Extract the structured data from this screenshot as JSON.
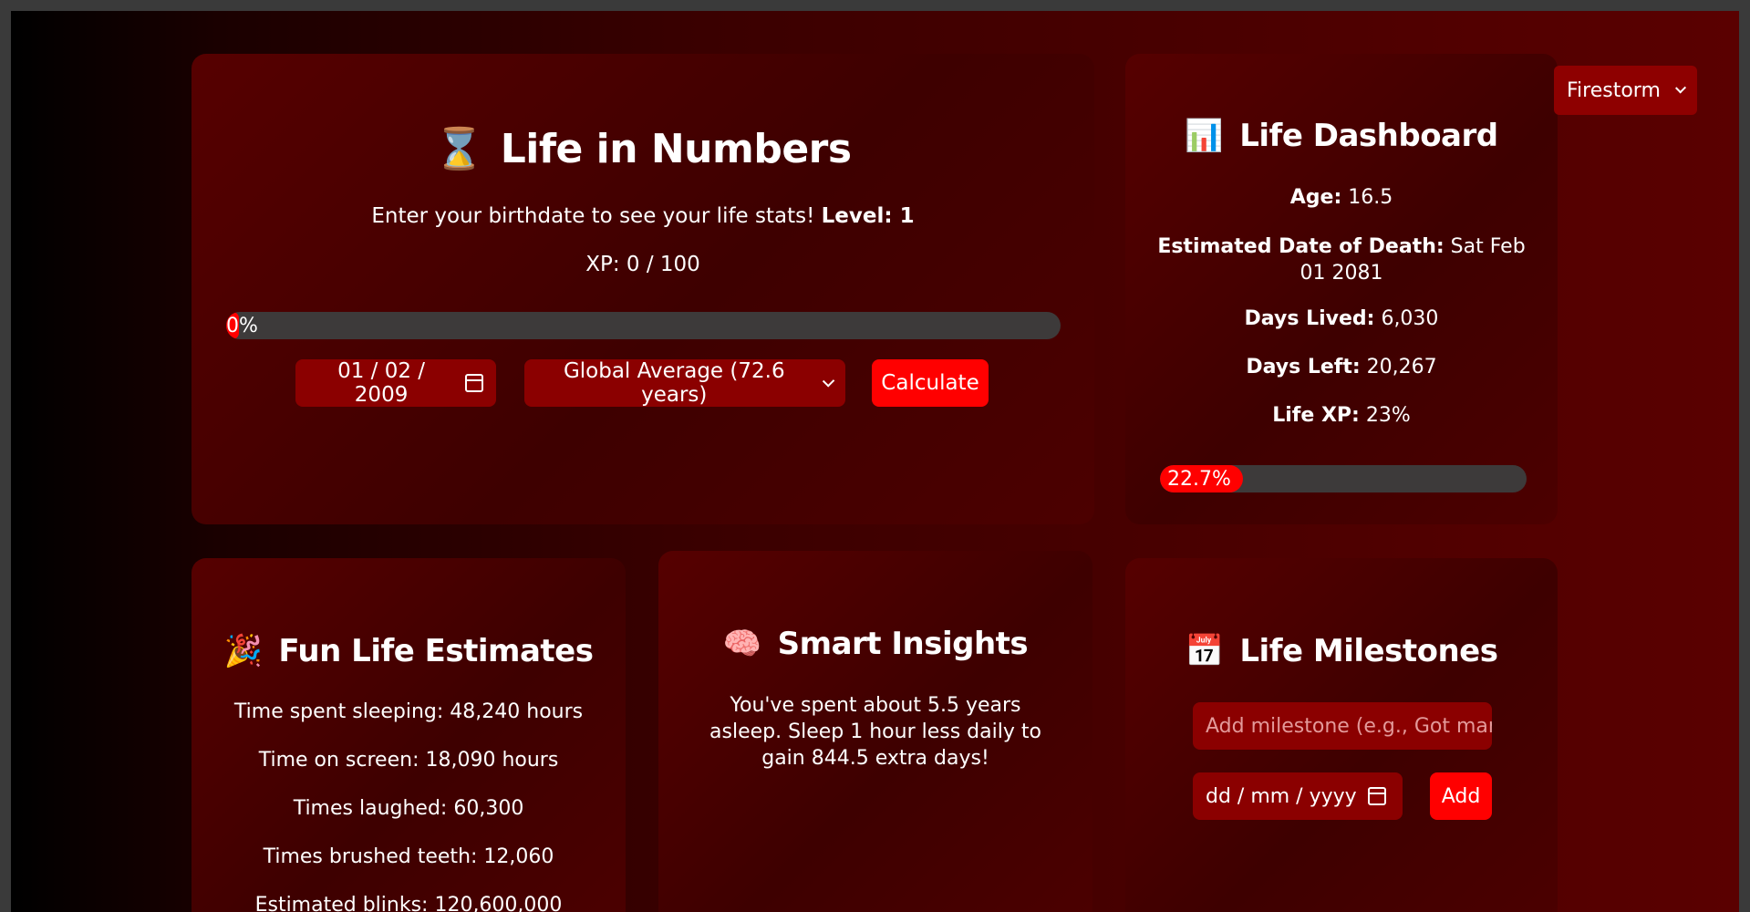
{
  "theme_select": {
    "value": "Firestorm"
  },
  "main_card": {
    "icon": "⌛",
    "title": "Life in Numbers",
    "prompt": "Enter your birthdate to see your life stats!",
    "level_label": "Level: 1",
    "xp_text": "XP: 0 / 100",
    "progress_text": "0%",
    "progress_fraction": 0.0,
    "date_value": "01 / 02 / 2009",
    "lifespan_select": "Global Average (72.6 years)",
    "calculate_label": "Calculate"
  },
  "dashboard": {
    "icon": "📊",
    "title": "Life Dashboard",
    "age_label": "Age:",
    "age_value": " 16.5",
    "death_label": "Estimated Date of Death:",
    "death_value": " Sat Feb 01 2081",
    "days_lived_label": "Days Lived:",
    "days_lived_value": " 6,030",
    "days_left_label": "Days Left:",
    "days_left_value": " 20,267",
    "life_xp_label": "Life XP:",
    "life_xp_value": " 23%",
    "progress_text": "22.7%",
    "progress_fraction": 0.227
  },
  "fun": {
    "icon": "🎉",
    "title": "Fun Life Estimates",
    "items": [
      "Time spent sleeping: 48,240 hours",
      "Time on screen: 18,090 hours",
      "Times laughed: 60,300",
      "Times brushed teeth: 12,060",
      "Estimated blinks: 120,600,000"
    ]
  },
  "insights": {
    "icon": "🧠",
    "title": "Smart Insights",
    "text": "You've spent about 5.5 years asleep. Sleep 1 hour less daily to gain 844.5 extra days!"
  },
  "milestones": {
    "icon": "📅",
    "title": "Life Milestones",
    "input_placeholder": "Add milestone (e.g., Got mar",
    "date_placeholder": "dd / mm / yyyy",
    "add_label": "Add"
  }
}
